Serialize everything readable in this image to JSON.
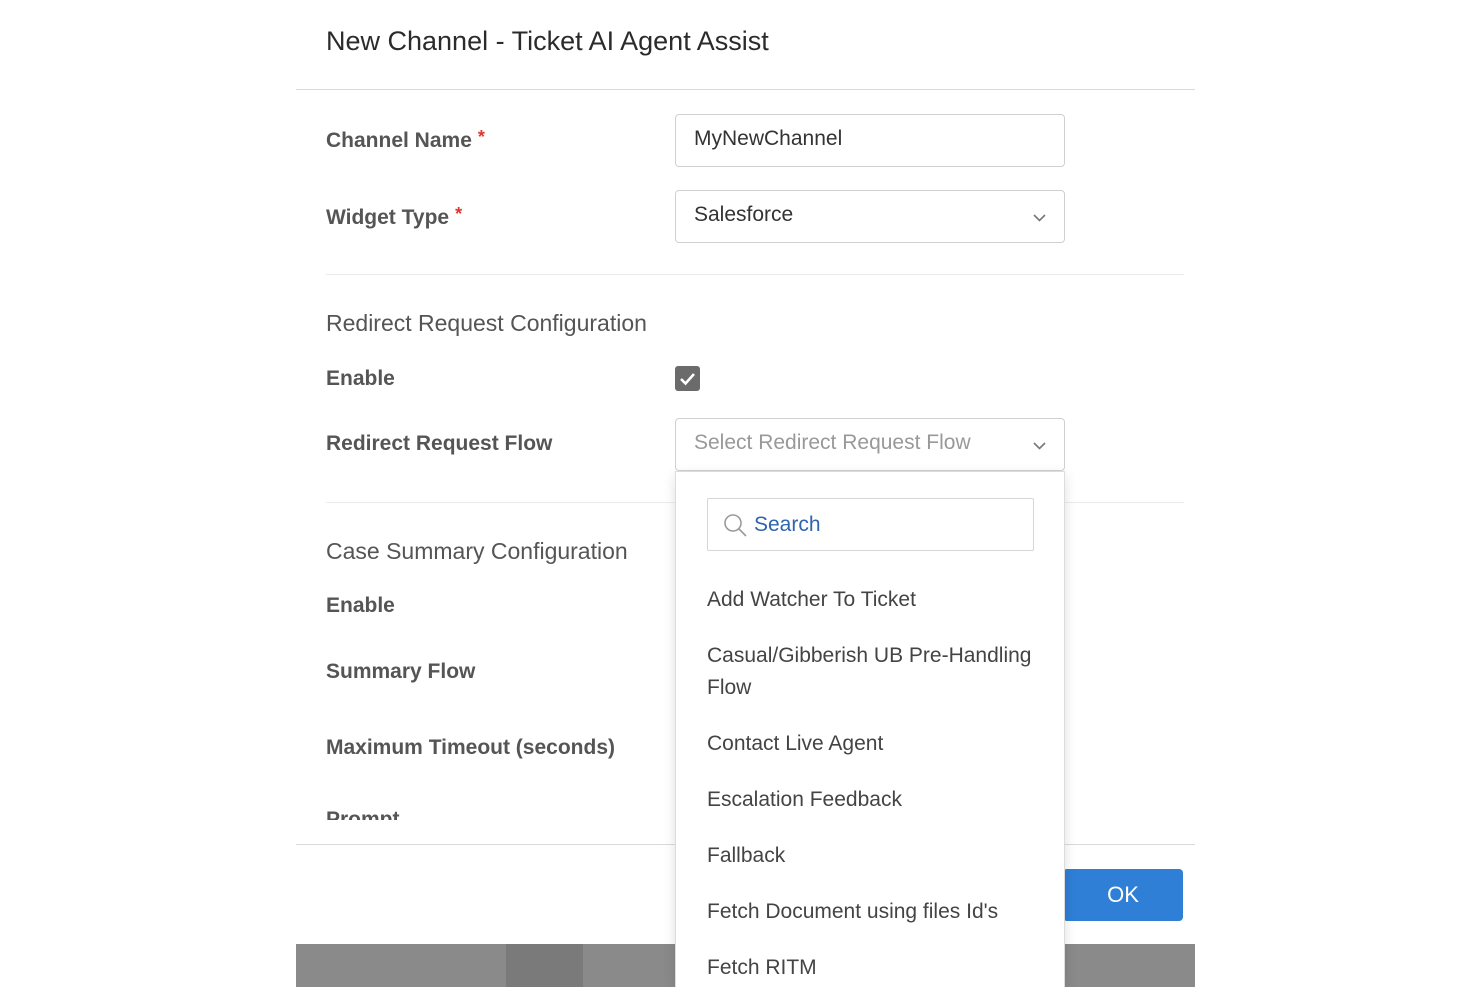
{
  "modal": {
    "title": "New Channel - Ticket AI Agent Assist"
  },
  "form": {
    "channel_name_label": "Channel Name",
    "channel_name_value": "MyNewChannel",
    "widget_type_label": "Widget Type",
    "widget_type_value": "Salesforce",
    "required_marker": "*"
  },
  "redirect_section": {
    "title": "Redirect Request Configuration",
    "enable_label": "Enable",
    "enable_checked": true,
    "flow_label": "Redirect Request Flow",
    "flow_placeholder": "Select Redirect Request Flow"
  },
  "summary_section": {
    "title": "Case Summary Configuration",
    "enable_label": "Enable",
    "flow_label": "Summary Flow",
    "timeout_label": "Maximum Timeout (seconds)",
    "prompt_label": "Prompt"
  },
  "dropdown": {
    "search_placeholder": "Search",
    "options": [
      "Add Watcher To Ticket",
      "Casual/Gibberish UB Pre-Handling Flow",
      "Contact Live Agent",
      "Escalation Feedback",
      "Fallback",
      "Fetch Document using files Id's",
      "Fetch RITM"
    ]
  },
  "footer": {
    "ok_label": "OK"
  },
  "colors": {
    "primary": "#2f7fd6",
    "required": "#e0352b",
    "checkbox": "#6b6b6b"
  }
}
